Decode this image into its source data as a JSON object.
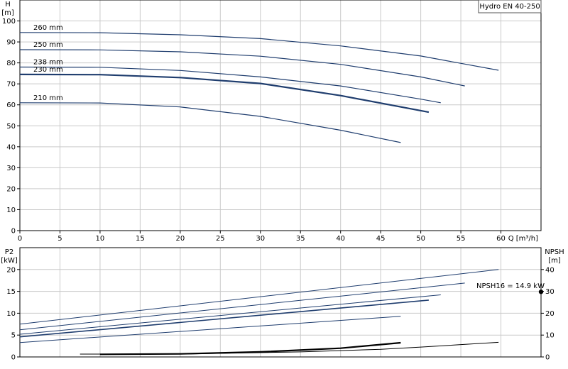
{
  "chart_data": [
    {
      "type": "line",
      "legend_label": "Hydro EN 40-250",
      "y_axis_label": [
        "H",
        "[m]"
      ],
      "x_axis_label": "Q [m³/h]",
      "xlim": [
        0,
        65
      ],
      "ylim": [
        0,
        110
      ],
      "x_ticks": [
        0,
        5,
        10,
        15,
        20,
        25,
        30,
        35,
        40,
        45,
        50,
        55,
        60
      ],
      "y_ticks": [
        0,
        10,
        20,
        30,
        40,
        50,
        60,
        70,
        80,
        90,
        100
      ],
      "grid": true,
      "series": [
        {
          "name": "260 mm",
          "color": "#1f3d6e",
          "width": 1.2,
          "x": [
            0,
            10,
            20,
            30,
            40,
            50,
            59.7
          ],
          "y": [
            94.5,
            94.4,
            93.4,
            91.6,
            88.1,
            83.3,
            76.5
          ]
        },
        {
          "name": "250 mm",
          "color": "#1f3d6e",
          "width": 1.2,
          "x": [
            0,
            10,
            20,
            30,
            40,
            50,
            55.5
          ],
          "y": [
            86.3,
            86.2,
            85.3,
            83.2,
            79.3,
            73.3,
            69
          ]
        },
        {
          "name": "238 mm",
          "color": "#1f3d6e",
          "width": 1.2,
          "x": [
            0,
            10,
            20,
            30,
            40,
            50,
            52.5
          ],
          "y": [
            78,
            77.9,
            76.4,
            73.3,
            69,
            62.7,
            61
          ]
        },
        {
          "name": "230 mm",
          "color": "#1f3d6e",
          "width": 2.2,
          "x": [
            0,
            10,
            20,
            30,
            40,
            51
          ],
          "y": [
            74.5,
            74.4,
            73,
            70.2,
            64.4,
            56.5
          ]
        },
        {
          "name": "210 mm",
          "color": "#1f3d6e",
          "width": 1.2,
          "x": [
            0,
            10,
            20,
            30,
            40,
            47.5
          ],
          "y": [
            61,
            60.9,
            59,
            54.5,
            47.9,
            42
          ]
        }
      ]
    },
    {
      "type": "line",
      "y_axis_label": [
        "P2",
        "[kW]"
      ],
      "y2_axis_label": [
        "NPSH",
        "[m]"
      ],
      "xlim": [
        0,
        65
      ],
      "ylim": [
        0,
        25
      ],
      "y2lim": [
        0,
        50
      ],
      "y_ticks": [
        0,
        5,
        10,
        15,
        20
      ],
      "y2_ticks": [
        0,
        10,
        20,
        30,
        40
      ],
      "grid": true,
      "annotation": {
        "text": "NPSH16 = 14.9 kW",
        "value": 29.8
      },
      "series": [
        {
          "axis": "P2",
          "color": "#1f3d6e",
          "width": 1,
          "x": [
            0,
            59.7
          ],
          "y": [
            7.5,
            20
          ]
        },
        {
          "axis": "P2",
          "color": "#1f3d6e",
          "width": 1,
          "x": [
            0,
            55.5
          ],
          "y": [
            6.2,
            16.9
          ]
        },
        {
          "axis": "P2",
          "color": "#1f3d6e",
          "width": 1,
          "x": [
            0,
            52.5
          ],
          "y": [
            5.2,
            14.2
          ]
        },
        {
          "axis": "P2",
          "color": "#1f3d6e",
          "width": 1.6,
          "x": [
            0,
            51
          ],
          "y": [
            4.6,
            13
          ]
        },
        {
          "axis": "P2",
          "color": "#1f3d6e",
          "width": 1,
          "x": [
            0,
            47.5
          ],
          "y": [
            3.3,
            9.3
          ]
        },
        {
          "axis": "NPSH",
          "color": "#000000",
          "width": 1,
          "x": [
            7.5,
            20,
            35,
            45,
            50,
            59.7
          ],
          "y": [
            1.3,
            1.3,
            2.3,
            3.5,
            4.5,
            6.7
          ]
        },
        {
          "axis": "NPSH",
          "color": "#000000",
          "width": 2.2,
          "x": [
            10,
            20,
            30,
            40,
            47.5
          ],
          "y": [
            1.2,
            1.4,
            2.3,
            4,
            6.5
          ]
        }
      ]
    }
  ]
}
